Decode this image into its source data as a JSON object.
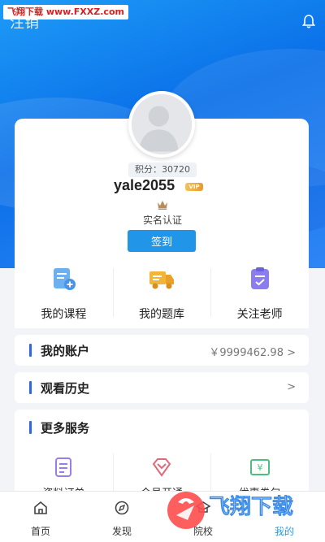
{
  "watermark": "飞翔下载 www.FXXZ.com",
  "header": {
    "left_label": "注销",
    "bell_icon": "bell-icon"
  },
  "profile": {
    "points": "积分：30720",
    "username": "yale2055",
    "vip": "VIP",
    "verify": "实名认证",
    "sign_button": "签到"
  },
  "quick": [
    {
      "label": "我的课程",
      "icon": "course-icon",
      "color": "#6bb0f0"
    },
    {
      "label": "我的题库",
      "icon": "question-bank-icon",
      "color": "#f2b53a"
    },
    {
      "label": "关注老师",
      "icon": "teacher-icon",
      "color": "#8b7df0"
    }
  ],
  "account": {
    "title": "我的账户",
    "value": "￥9999462.98 >"
  },
  "history": {
    "title": "观看历史",
    "arrow": ">"
  },
  "services": {
    "title": "更多服务",
    "items": [
      {
        "label": "资料订单",
        "icon": "document-icon",
        "color": "#9b7de8"
      },
      {
        "label": "会员开通",
        "icon": "diamond-icon",
        "color": "#e06a7a"
      },
      {
        "label": "优惠券包",
        "icon": "coupon-icon",
        "color": "#4cbf7e"
      }
    ]
  },
  "tabs": [
    {
      "label": "首页",
      "icon": "home-icon"
    },
    {
      "label": "发现",
      "icon": "discover-icon"
    },
    {
      "label": "院校",
      "icon": "school-icon"
    },
    {
      "label": "我的",
      "icon": "user-icon"
    }
  ],
  "colors": {
    "primary": "#2196e8",
    "header": "#0a6fe8",
    "accent_bar": "#2d6ad9"
  },
  "brand_watermark": {
    "text": "飞翔下载",
    "url": "www.FXXZ.com"
  }
}
